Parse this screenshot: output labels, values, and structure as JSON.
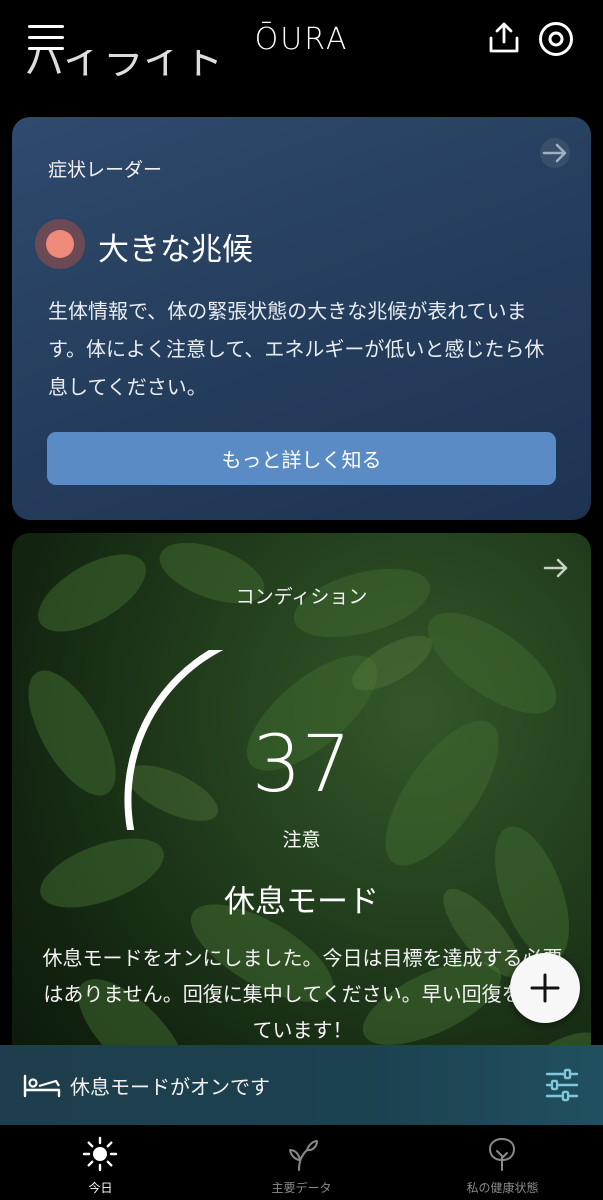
{
  "header": {
    "logo": "ŌURA",
    "partial_heading": "ハイライト"
  },
  "symptom_radar": {
    "title": "症状レーダー",
    "status": "大きな兆候",
    "description": "生体情報で、体の緊張状態の大きな兆候が表れています。体によく注意して、エネルギーが低いと感じたら休息してください。",
    "button_label": "もっと詳しく知る",
    "status_color": "#f08a7a"
  },
  "condition": {
    "title": "コンディション",
    "score": "37",
    "score_label": "注意",
    "score_fraction": 0.37,
    "mode_title": "休息モード",
    "description": "休息モードをオンにしました。今日は目標を達成する必要はありません。回復に集中してください。早い回復を願っています！"
  },
  "rest_banner": {
    "text": "休息モードがオンです"
  },
  "bottom_nav": {
    "items": [
      {
        "label": "今日",
        "icon": "sun-icon",
        "active": true
      },
      {
        "label": "主要データ",
        "icon": "sprout-icon",
        "active": false
      },
      {
        "label": "私の健康状態",
        "icon": "tree-icon",
        "active": false
      }
    ]
  }
}
